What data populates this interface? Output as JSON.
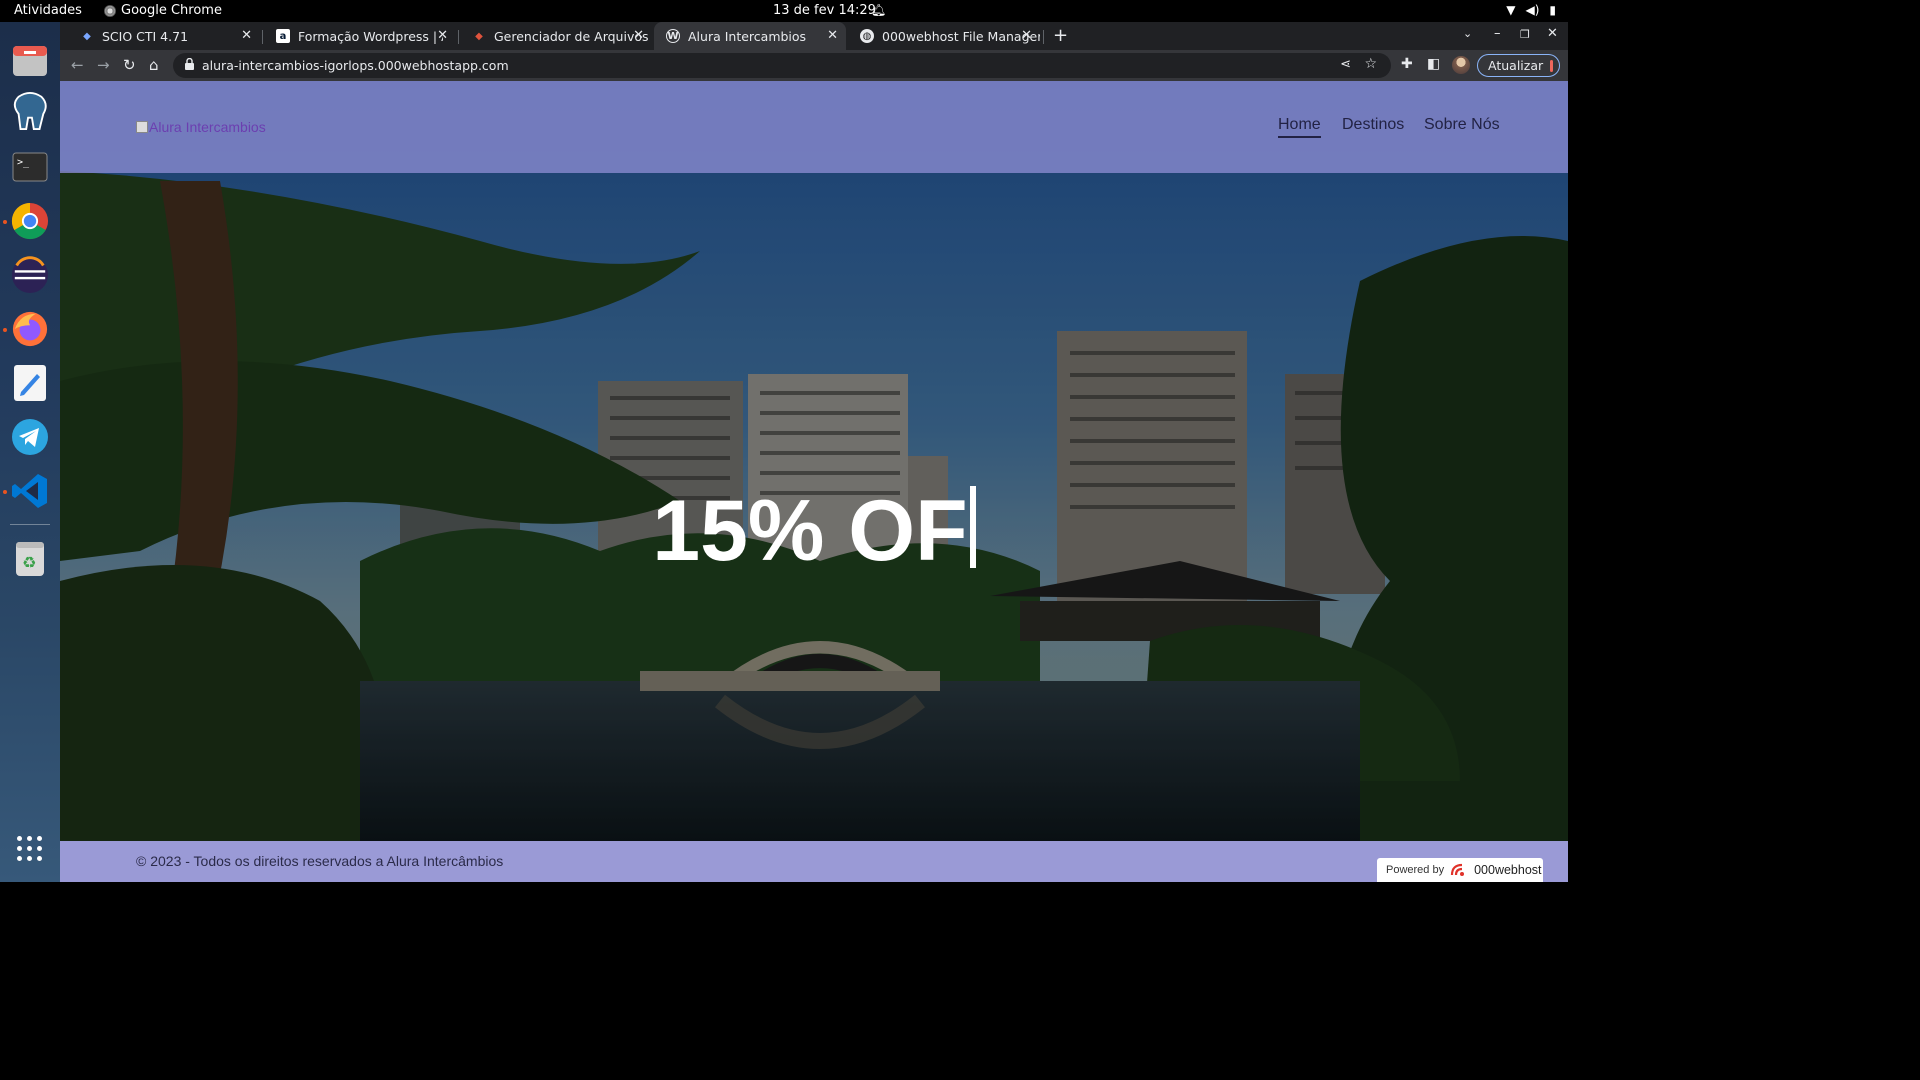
{
  "os_bar": {
    "activities": "Atividades",
    "app_name": "Google Chrome",
    "clock": "13 de fev  14:29"
  },
  "dock": {
    "items": [
      {
        "name": "files-icon"
      },
      {
        "name": "postgres-elephant-icon"
      },
      {
        "name": "terminal-icon"
      },
      {
        "name": "chrome-icon"
      },
      {
        "name": "eclipse-icon"
      },
      {
        "name": "firefox-icon"
      },
      {
        "name": "text-editor-icon"
      },
      {
        "name": "telegram-icon"
      },
      {
        "name": "vscode-icon"
      },
      {
        "name": "trash-icon"
      }
    ]
  },
  "browser": {
    "tabs": [
      {
        "label": "SCIO CTI 4.71",
        "active": false
      },
      {
        "label": "Formação Wordpress | Al",
        "active": false
      },
      {
        "label": "Gerenciador de Arquivos",
        "active": false
      },
      {
        "label": "Alura Intercambios",
        "active": true
      },
      {
        "label": "000webhost File Manager",
        "active": false
      }
    ],
    "url": "alura-intercambios-igorlops.000webhostapp.com",
    "update_button": "Atualizar"
  },
  "site": {
    "logo_alt": "Alura Intercambios",
    "nav": [
      {
        "label": "Home",
        "current": true
      },
      {
        "label": "Destinos",
        "current": false
      },
      {
        "label": "Sobre Nós",
        "current": false
      }
    ],
    "promo": "15% OF",
    "copyright": "© 2023 - Todos os direitos reservados a Alura Intercâmbios",
    "powered_by": "Powered by",
    "host_brand": "000webhost"
  },
  "colors": {
    "header_overlay": "#8c8cd2",
    "footer": "#9a9ad6",
    "chrome_dark": "#202124",
    "chrome_toolbar": "#35363a"
  }
}
